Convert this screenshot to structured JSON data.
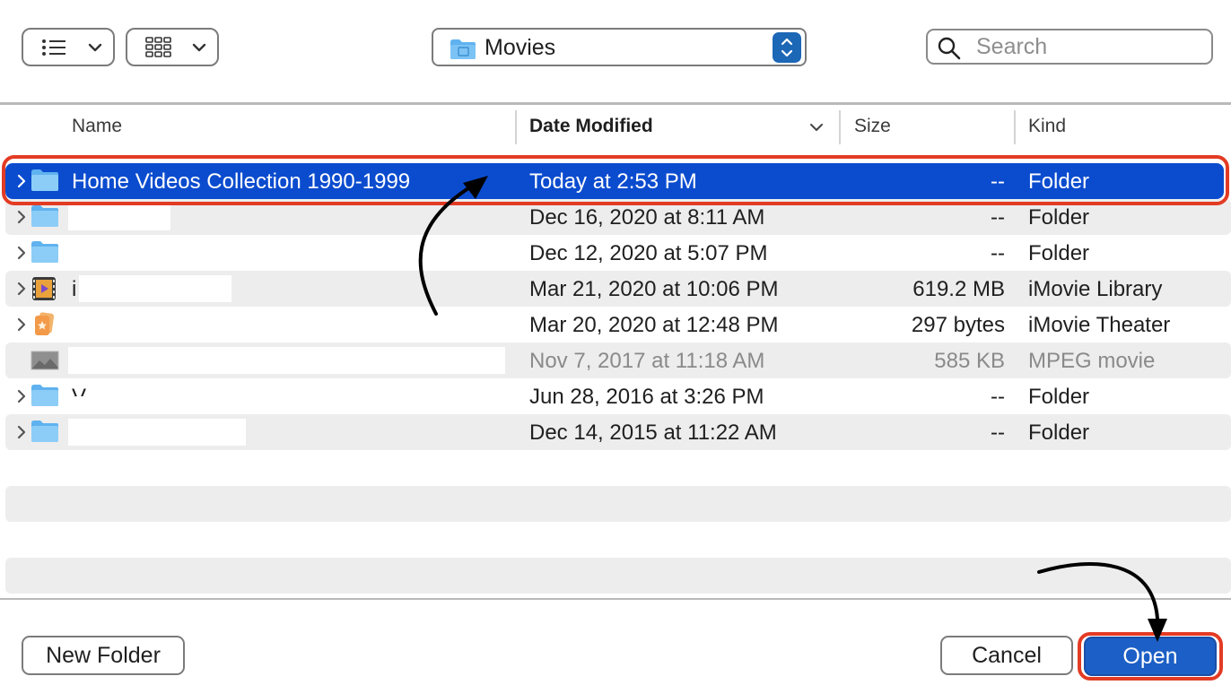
{
  "toolbar": {
    "list_view_icon": "list-icon",
    "grid_view_icon": "grid-icon",
    "location": "Movies",
    "search_placeholder": "Search"
  },
  "columns": {
    "name": "Name",
    "date_modified": "Date Modified",
    "size": "Size",
    "kind": "Kind"
  },
  "rows": [
    {
      "name": "Home Videos Collection 1990-1999",
      "date": "Today at 2:53 PM",
      "size": "--",
      "kind": "Folder",
      "icon": "folder-icon"
    },
    {
      "name": "",
      "date": "Dec 16, 2020 at 8:11 AM",
      "size": "--",
      "kind": "Folder",
      "icon": "folder-icon"
    },
    {
      "name": "",
      "date": "Dec 12, 2020 at 5:07 PM",
      "size": "--",
      "kind": "Folder",
      "icon": "folder-icon"
    },
    {
      "name": "i",
      "date": "Mar 21, 2020 at 10:06 PM",
      "size": "619.2 MB",
      "kind": "iMovie Library",
      "icon": "imovie-library-icon"
    },
    {
      "name": "",
      "date": "Mar 20, 2020 at 12:48 PM",
      "size": "297 bytes",
      "kind": "iMovie Theater",
      "icon": "imovie-theater-icon"
    },
    {
      "name": "",
      "date": "Nov 7, 2017 at 11:18 AM",
      "size": "585 KB",
      "kind": "MPEG movie",
      "icon": "movie-thumbnail-icon"
    },
    {
      "name": "V",
      "date": "Jun 28, 2016 at 3:26 PM",
      "size": "--",
      "kind": "Folder",
      "icon": "folder-icon"
    },
    {
      "name": "",
      "date": "Dec 14, 2015 at 11:22 AM",
      "size": "--",
      "kind": "Folder",
      "icon": "folder-icon"
    }
  ],
  "buttons": {
    "new_folder": "New Folder",
    "cancel": "Cancel",
    "open": "Open"
  },
  "colors": {
    "selection": "#0b4ccf",
    "annotation_ring": "#e33b24",
    "primary_button": "#1c5fc6"
  }
}
